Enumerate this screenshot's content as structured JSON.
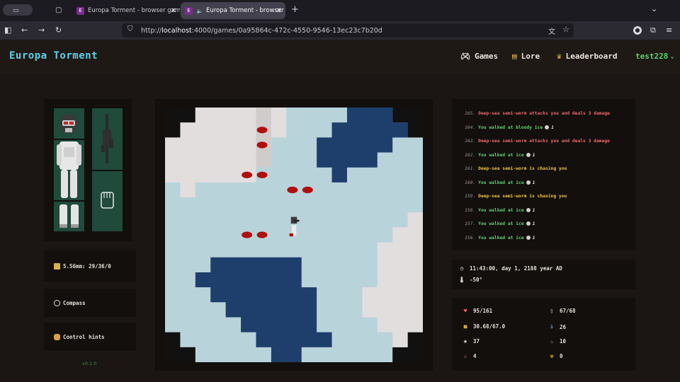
{
  "browser": {
    "tabs": [
      {
        "title": "Europa Torment - browser game",
        "active": false
      },
      {
        "title": "Europa Torment - browser g",
        "active": true
      }
    ],
    "url_prefix": "http://",
    "url_host": "localhost",
    "url_path": ":4000/games/0a95864c-472c-4550-9546-13ec23c7b20d"
  },
  "header": {
    "logo": "Europa Torment",
    "nav": [
      {
        "label": "Games",
        "icon": "gamepad-icon"
      },
      {
        "label": "Lore",
        "icon": "book-icon"
      },
      {
        "label": "Leaderboard",
        "icon": "trophy-icon"
      }
    ],
    "user": "test228",
    "user_caret": "⌄"
  },
  "left": {
    "ammo": "5.56mm: 29/36/0",
    "compass": "Compass",
    "control_hints": "Control hints",
    "version": "v0.1.0"
  },
  "log": [
    {
      "num": "165.",
      "text": "Deep-sea semi-worm attacks you and deals 3 damage",
      "color": "red"
    },
    {
      "num": "164.",
      "text": "You walked at bloody ice",
      "color": "green",
      "cost": "1"
    },
    {
      "num": "163.",
      "text": "Deep-sea semi-worm attacks you and deals 3 damage",
      "color": "red"
    },
    {
      "num": "162.",
      "text": "You walked at ice",
      "color": "green",
      "cost": "1"
    },
    {
      "num": "161.",
      "text": "Deep-sea semi-worm is chasing you",
      "color": "yellow"
    },
    {
      "num": "160.",
      "text": "You walked at ice",
      "color": "green",
      "cost": "1"
    },
    {
      "num": "159.",
      "text": "Deep-sea semi-worm is chasing you",
      "color": "yellow"
    },
    {
      "num": "158.",
      "text": "You walked at ice",
      "color": "green",
      "cost": "1"
    },
    {
      "num": "157.",
      "text": "You walked at ice",
      "color": "green",
      "cost": "1"
    },
    {
      "num": "156.",
      "text": "You walked at ice",
      "color": "green",
      "cost": "1"
    }
  ],
  "time": {
    "clock": "11:43:00, day 1, 2188 year AD",
    "temperature": "-50°"
  },
  "stats": {
    "health": "95/161",
    "oxygen": "67/68",
    "weight": "30.68/67.0",
    "water": "26",
    "food": "37",
    "hunger": "10",
    "attack": "4",
    "radiation": "0"
  },
  "colors": {
    "ice": "#b9d3da",
    "deep_ice": "#1e3f6c",
    "snow": "#e3dede",
    "blood": "#b10e0e",
    "accent": "#5fd1ec",
    "user": "#58d36a"
  }
}
